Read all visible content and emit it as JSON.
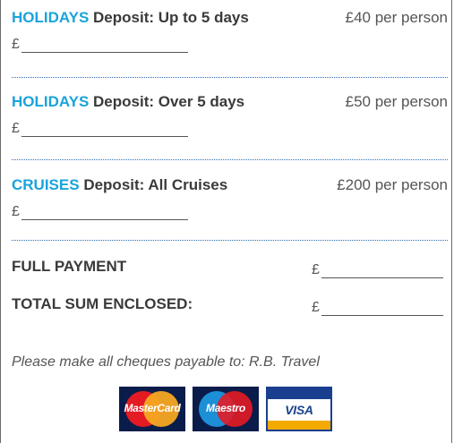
{
  "deposits": [
    {
      "accent": "HOLIDAYS",
      "label": "Deposit: Up to 5 days",
      "price": "£40 per person",
      "currency": "£"
    },
    {
      "accent": "HOLIDAYS",
      "label": "Deposit: Over 5 days",
      "price": "£50 per person",
      "currency": "£"
    },
    {
      "accent": "CRUISES",
      "label": "Deposit: All Cruises",
      "price": "£200 per person",
      "currency": "£"
    }
  ],
  "payment": {
    "full_label": "FULL PAYMENT",
    "total_label": "TOTAL SUM ENCLOSED:",
    "currency": "£"
  },
  "note": "Please make all cheques payable to: R.B. Travel",
  "cards": {
    "mastercard": "MasterCard",
    "maestro": "Maestro",
    "visa": "VISA"
  },
  "colors": {
    "accent": "#1aa3db",
    "divider": "#2b6cb8"
  }
}
